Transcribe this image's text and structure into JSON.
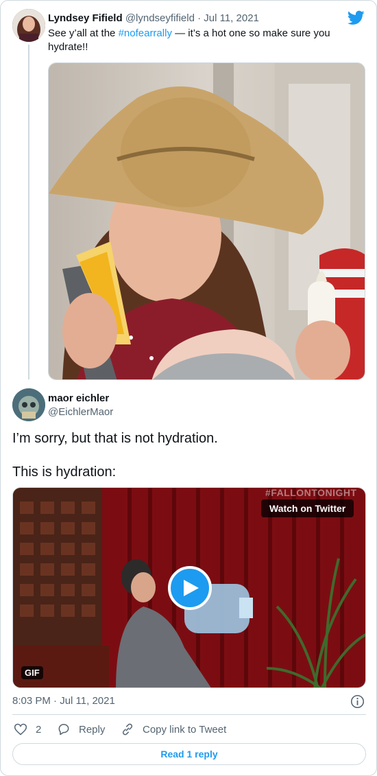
{
  "parent_tweet": {
    "display_name": "Lyndsey Fifield",
    "handle": "@lyndseyfifield",
    "separator": "·",
    "date": "Jul 11, 2021",
    "text_before": "See y’all at the ",
    "hashtag": "#nofearrally",
    "text_after": " — it’s a hot one so make sure you hydrate!!"
  },
  "main_tweet": {
    "display_name": "maor eichler",
    "handle": "@EichlerMaor",
    "text_line1": "I’m sorry, but that is not hydration.",
    "text_line2": "This is hydration:",
    "media": {
      "watch_label": "Watch on Twitter",
      "gif_label": "GIF",
      "watermark": "#FALLONTONIGHT"
    },
    "timestamp": "8:03 PM · Jul 11, 2021",
    "like_count": "2",
    "reply_label": "Reply",
    "copy_label": "Copy link to Tweet",
    "read_replies_label": "Read 1 reply"
  },
  "colors": {
    "accent": "#1d9bf0",
    "muted": "#536471",
    "border": "#cfd9de"
  },
  "icons": [
    "twitter-bird-icon",
    "play-icon",
    "info-icon",
    "heart-icon",
    "reply-icon",
    "link-icon"
  ]
}
